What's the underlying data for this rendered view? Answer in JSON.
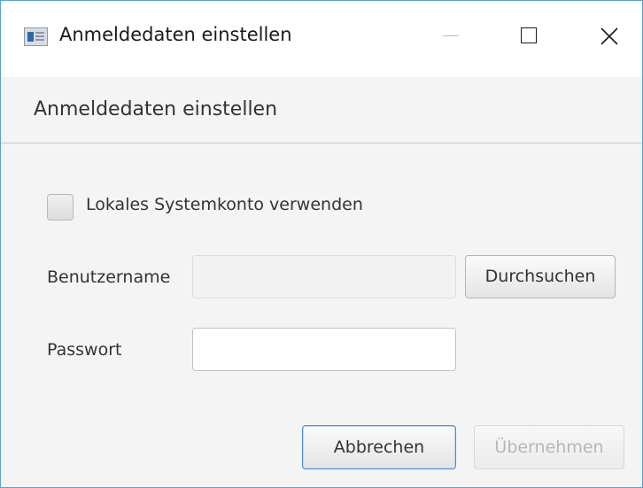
{
  "window": {
    "title": "Anmeldedaten einstellen"
  },
  "header": {
    "title": "Anmeldedaten einstellen"
  },
  "form": {
    "local_account_label": "Lokales Systemkonto verwenden",
    "local_account_checked": false,
    "username_label": "Benutzername",
    "username_value": "",
    "password_label": "Passwort",
    "password_value": "",
    "browse_label": "Durchsuchen"
  },
  "buttons": {
    "cancel_label": "Abbrechen",
    "apply_label": "Übernehmen"
  },
  "colors": {
    "focus_border": "#4c8fd0",
    "disabled_text": "#b7b7b7",
    "window_border": "#5aa0d8"
  },
  "icons": {
    "app": "app-window-icon",
    "minimize": "minimize-icon",
    "maximize": "maximize-icon",
    "close": "close-icon"
  }
}
